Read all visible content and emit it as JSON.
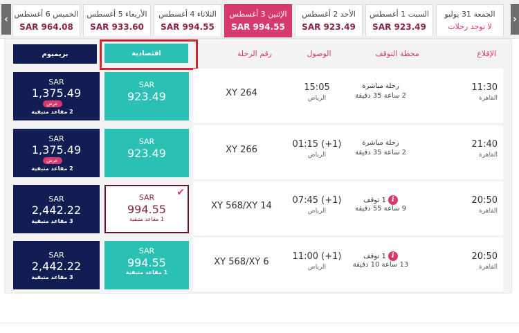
{
  "date_tabs": [
    {
      "date": "الخميس 6 أغسطس",
      "price": "SAR 964.08"
    },
    {
      "date": "الأربعاء 5 أغسطس",
      "price": "SAR 933.60"
    },
    {
      "date": "الثلاثاء 4 أغسطس",
      "price": "SAR 994.55"
    },
    {
      "date": "الإثنين 3 أغسطس",
      "price": "SAR 994.55"
    },
    {
      "date": "الأحد 2 أغسطس",
      "price": "SAR 923.49"
    },
    {
      "date": "السبت 1 أغسطس",
      "price": "SAR 923.49"
    },
    {
      "date": "الجمعة 31 يوليو",
      "note": "لا توجد رحلات"
    }
  ],
  "arrows": {
    "left": "‹",
    "right": "›"
  },
  "headers": {
    "departure": "الإقلاع",
    "stop_station": "محطة التوقف",
    "arrival": "الوصول",
    "flight_number": "رقم الرحلة",
    "economy": "اقتصادية",
    "premium": "بريميوم"
  },
  "rows": [
    {
      "dep_time": "11:30",
      "dep_city": "القاهرة",
      "stop_type": "رحلة مباشرة",
      "duration": "2 ساعة 35 دقيقة",
      "arr_time": "15:05",
      "arr_city": "الرياض",
      "flight_no": "XY 264",
      "eco_currency": "SAR",
      "eco_price": "923.49",
      "eco_seats": "",
      "prem_currency": "SAR",
      "prem_price": "1,375.49",
      "prem_badge": "عرض",
      "prem_seats": "2 مقاعد متبقية"
    },
    {
      "dep_time": "21:40",
      "dep_city": "القاهرة",
      "stop_type": "رحلة مباشرة",
      "duration": "2 ساعة 35 دقيقة",
      "arr_time": "01:15 (+1)",
      "arr_city": "الرياض",
      "flight_no": "XY 266",
      "eco_currency": "SAR",
      "eco_price": "923.49",
      "eco_seats": "",
      "prem_currency": "SAR",
      "prem_price": "1,375.49",
      "prem_badge": "عرض",
      "prem_seats": "2 مقاعد متبقية"
    },
    {
      "dep_time": "20:50",
      "dep_city": "القاهرة",
      "stop_type": "1 توقف",
      "duration": "9 ساعة 55 دقيقة",
      "arr_time": "07:45 (+1)",
      "arr_city": "الرياض",
      "flight_no": "XY 568/XY 14",
      "eco_currency": "SAR",
      "eco_price": "994.55",
      "eco_seats": "1 مقاعد متبقية",
      "prem_currency": "SAR",
      "prem_price": "2,442.22",
      "prem_badge": "",
      "prem_seats": "3 مقاعد متبقية"
    },
    {
      "dep_time": "20:50",
      "dep_city": "القاهرة",
      "stop_type": "1 توقف",
      "duration": "13 ساعة 10 دقيقة",
      "arr_time": "11:00 (+1)",
      "arr_city": "الرياض",
      "flight_no": "XY 568/XY 6",
      "eco_currency": "SAR",
      "eco_price": "994.55",
      "eco_seats": "1 مقاعد متبقية",
      "prem_currency": "SAR",
      "prem_price": "2,442.22",
      "prem_badge": "",
      "prem_seats": "3 مقاعد متبقية"
    }
  ],
  "icons": {
    "info": "i",
    "check": "✔"
  },
  "colors": {
    "accent": "#d63a6d",
    "economy": "#2bc0b4",
    "premium": "#121d54",
    "price": "#8a2440",
    "highlight": "#d1262f"
  }
}
